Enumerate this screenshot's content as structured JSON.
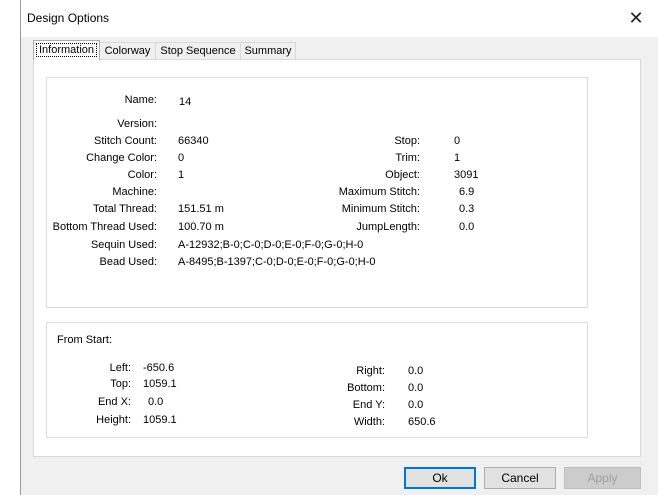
{
  "window": {
    "title": "Design Options",
    "close_glyph": "✕"
  },
  "tabs": [
    {
      "label": "Information",
      "active": true
    },
    {
      "label": "Colorway",
      "active": false
    },
    {
      "label": "Stop Sequence",
      "active": false
    },
    {
      "label": "Summary",
      "active": false
    }
  ],
  "info": {
    "name_label": "Name:",
    "name": "14",
    "version_label": "Version:",
    "version": "",
    "stitch_count_label": "Stitch Count:",
    "stitch_count": "66340",
    "change_color_label": "Change Color:",
    "change_color": "0",
    "color_label": "Color:",
    "color": "1",
    "machine_label": "Machine:",
    "machine": "",
    "total_thread_label": "Total Thread:",
    "total_thread": "151.51 m",
    "bottom_thread_label": "Bottom Thread Used:",
    "bottom_thread": "100.70 m",
    "sequin_label": "Sequin Used:",
    "sequin": "A-12932;B-0;C-0;D-0;E-0;F-0;G-0;H-0",
    "bead_label": "Bead Used:",
    "bead": "A-8495;B-1397;C-0;D-0;E-0;F-0;G-0;H-0",
    "stop_label": "Stop:",
    "stop": "0",
    "trim_label": "Trim:",
    "trim": "1",
    "object_label": "Object:",
    "object": "3091",
    "max_stitch_label": "Maximum Stitch:",
    "max_stitch": "6.9",
    "min_stitch_label": "Minimum Stitch:",
    "min_stitch": "0.3",
    "jump_length_label": "JumpLength:",
    "jump_length": "0.0"
  },
  "from_start": {
    "heading": "From Start:",
    "left_label": "Left:",
    "left": "-650.6",
    "top_label": "Top:",
    "top": "1059.1",
    "endx_label": "End X:",
    "endx": "0.0",
    "height_label": "Height:",
    "height": "1059.1",
    "right_label": "Right:",
    "right": "0.0",
    "bottom_label": "Bottom:",
    "bottom": "0.0",
    "endy_label": "End Y:",
    "endy": "0.0",
    "width_label": "Width:",
    "width": "650.6"
  },
  "buttons": {
    "ok": "Ok",
    "cancel": "Cancel",
    "apply": "Apply"
  },
  "colors": {
    "accent": "#0078d7",
    "background_art": "#7a1e1e"
  }
}
